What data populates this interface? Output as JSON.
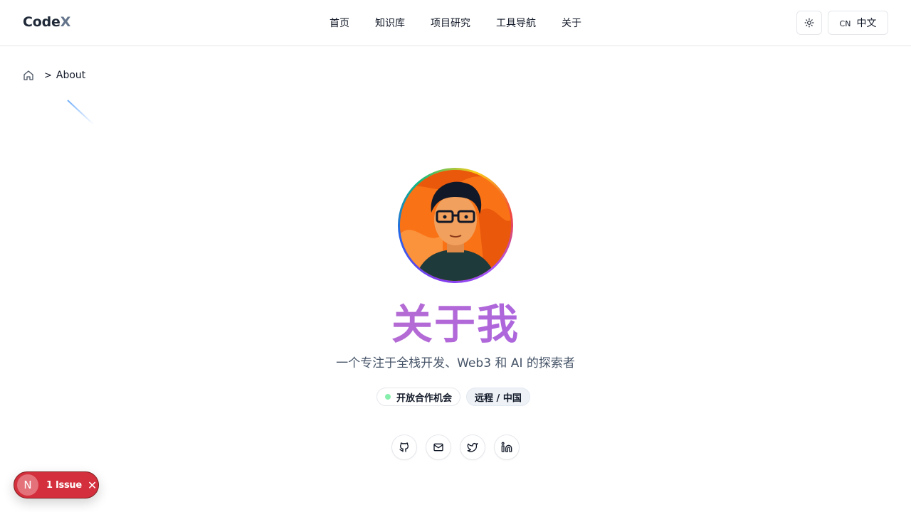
{
  "header": {
    "logo_main": "Code",
    "logo_accent": "X",
    "nav": [
      "首页",
      "知识库",
      "项目研究",
      "工具导航",
      "关于"
    ],
    "theme_icon": "sun-icon",
    "lang_code": "CN",
    "lang_label": "中文"
  },
  "breadcrumb": {
    "home_icon": "home-icon",
    "separator": ">",
    "current": "About"
  },
  "profile": {
    "title": "关于我",
    "subtitle": "一个专注于全栈开发、Web3 和 AI 的探索者",
    "badges": {
      "open": "开放合作机会",
      "location": "远程 / 中国"
    },
    "socials": [
      "github-icon",
      "mail-icon",
      "twitter-icon",
      "linkedin-icon"
    ]
  },
  "dev_overlay": {
    "initial": "N",
    "issues_label": "1 Issue",
    "close_glyph": "✕"
  },
  "colors": {
    "accent_purple": "#8b5cf6",
    "badge_dot": "#86efac",
    "issue_red": "#d32f3c"
  }
}
